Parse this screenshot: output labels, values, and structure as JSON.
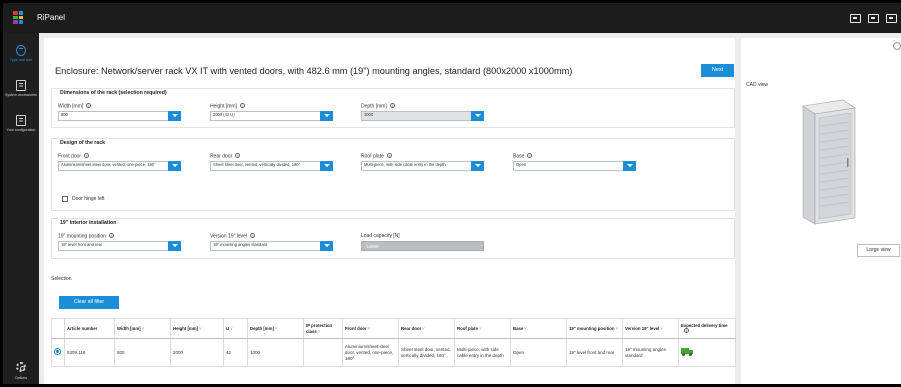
{
  "app": {
    "title": "RiPanel",
    "logo_colors": [
      "#e3342f",
      "#2a95e0",
      "#38b44a",
      "#f4c20d",
      "#8e44ad",
      "#1c8ed9"
    ]
  },
  "sidebar": {
    "items": [
      {
        "label": "Type and size",
        "icon": "cube-icon",
        "active": true
      },
      {
        "label": "System accessories",
        "icon": "accessories-icon",
        "active": false
      },
      {
        "label": "Your configuration",
        "icon": "document-icon",
        "active": false
      }
    ],
    "options_label": "Options"
  },
  "page": {
    "title": "Enclosure: Network/server rack VX IT with vented doors, with 482.6 mm (19\") mounting angles, standard (800x2000 x1000mm)",
    "next_label": "Next"
  },
  "dimensions": {
    "title": "Dimensions of the rack (selection required)",
    "width": {
      "label": "Width [mm]",
      "value": "800"
    },
    "height": {
      "label": "Height [mm]",
      "value": "2000 (42 U)"
    },
    "depth": {
      "label": "Depth [mm]",
      "value": "1000"
    }
  },
  "design": {
    "title": "Design of the rack",
    "front_door": {
      "label": "Front door",
      "value": "Aluminium/sheet steel door, vented, one-piece, 180°"
    },
    "rear_door": {
      "label": "Rear door",
      "value": "Sheet steel door, vented, vertically divided, 180°"
    },
    "roof_plate": {
      "label": "Roof plate",
      "value": "Multi-piece, with side cable entry in the depth"
    },
    "base": {
      "label": "Base",
      "value": "Open"
    },
    "hinge_label": "Door hinge left"
  },
  "interior": {
    "title": "19\" interior installation",
    "mounting": {
      "label": "19\" mounting position",
      "value": "19\" level front and rear"
    },
    "version": {
      "label": "Version 19\" level",
      "value": "19\" mounting angles standard"
    },
    "load": {
      "label": "Load capacity [N]",
      "value": "12000"
    }
  },
  "selection_label": "Selection",
  "clear_filter_label": "Clear all filter",
  "table": {
    "headers": [
      "Article number",
      "Width [mm]",
      "Height [mm]",
      "U",
      "Depth [mm]",
      "IP protection class",
      "Front door",
      "Rear door",
      "Roof plate",
      "Base",
      "19\" mounting position",
      "Version 19\" level",
      "Expected delivery time"
    ],
    "rows": [
      {
        "cells": [
          "5309.116",
          "800",
          "2000",
          "42",
          "1000",
          "",
          "Aluminium/sheet steel door, vented, one-piece, 180°",
          "Sheet steel door, vented, vertically divided, 180°",
          "Multi-piece, with side cable entry in the depth",
          "Open",
          "19\" level front and rear",
          "19\" mounting angles standard",
          ""
        ],
        "delivery_icon": "truck-icon"
      }
    ]
  },
  "right_panel": {
    "cad_label": "CAD view",
    "large_view_label": "Large view"
  },
  "colors": {
    "accent": "#1c8ed9",
    "titlebar": "#1c1c1c",
    "sidebar": "#1f1f1f",
    "delivery_ok": "#46a633"
  }
}
